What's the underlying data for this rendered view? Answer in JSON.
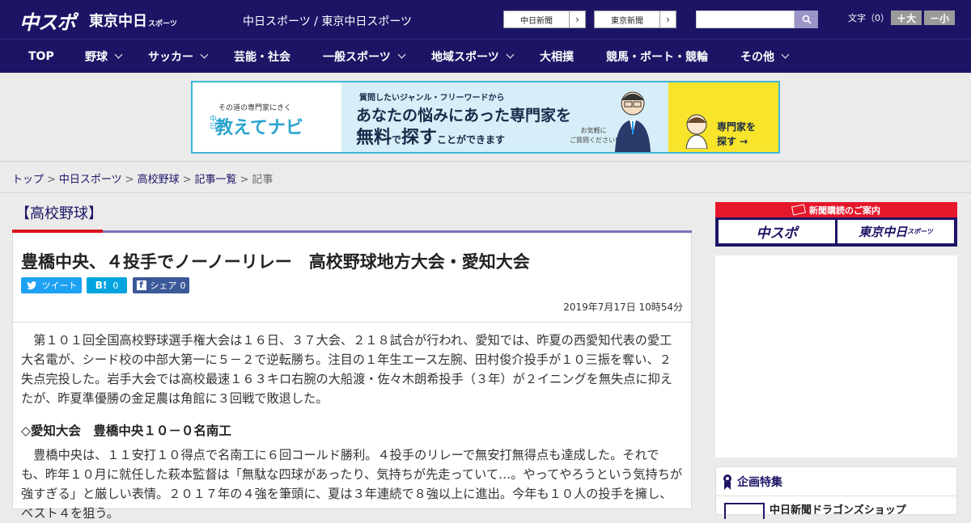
{
  "header": {
    "logo_main": "中スポ",
    "logo_tokyo": "東京中日",
    "logo_tokyo_sub": "スポーツ",
    "site_title": "中日スポーツ / 東京中日スポーツ",
    "links": [
      {
        "label": "中日新聞"
      },
      {
        "label": "東京新聞"
      }
    ],
    "search": {
      "placeholder": "",
      "icon": "search-icon"
    },
    "font_size": {
      "label": "文字（0）",
      "bigger": "＋大",
      "smaller": "－小"
    }
  },
  "nav": {
    "items": [
      {
        "label": "TOP",
        "dropdown": false
      },
      {
        "label": "野球",
        "dropdown": true
      },
      {
        "label": "サッカー",
        "dropdown": true
      },
      {
        "label": "芸能・社会",
        "dropdown": false
      },
      {
        "label": "一般スポーツ",
        "dropdown": true
      },
      {
        "label": "地域スポーツ",
        "dropdown": true
      },
      {
        "label": "大相撲",
        "dropdown": false
      },
      {
        "label": "競馬・ボート・競輪",
        "dropdown": false
      },
      {
        "label": "その他",
        "dropdown": true
      }
    ]
  },
  "banner": {
    "tagline": "その道の専門家にきく",
    "logo_prefix": "中日",
    "logo": "教えてナビ",
    "line1": "質問したいジャンル・フリーワードから",
    "line2": "あなたの悩みにあった専門家を",
    "line3_a": "無料",
    "line3_b": "で",
    "line3_c": "探す",
    "line3_d": "ことができます",
    "note_1": "お気軽に",
    "note_2": "ご質問ください!",
    "cta_1": "専門家を",
    "cta_2": "探す →"
  },
  "breadcrumb": {
    "items": [
      "トップ",
      "中日スポーツ",
      "高校野球",
      "記事一覧"
    ],
    "current": "記事",
    "separator": ">"
  },
  "article": {
    "category": "【高校野球】",
    "headline": "豊橋中央、４投手でノーノーリレー　高校野球地方大会・愛知大会",
    "share": {
      "tweet": "ツイート",
      "hatena": "B!",
      "hatena_count": "0",
      "facebook": "シェア",
      "facebook_count": "0"
    },
    "date": "2019年7月17日 10時54分",
    "para1": "第１０１回全国高校野球選手権大会は１６日、３７大会、２１８試合が行われ、愛知では、昨夏の西愛知代表の愛工大名電が、シード校の中部大第一に５－２で逆転勝ち。注目の１年生エース左腕、田村俊介投手が１０三振を奪い、２失点完投した。岩手大会では高校最速１６３キロ右腕の大船渡・佐々木朗希投手（３年）が２イニングを無失点に抑えたが、昨夏準優勝の金足農は角館に３回戦で敗退した。",
    "subhead": "◇愛知大会　豊橋中央１０－０名南工",
    "para2": "豊橋中央は、１１安打１０得点で名南工に６回コールド勝利。４投手のリレーで無安打無得点も達成した。それでも、昨年１０月に就任した萩本監督は「無駄な四球があったり、気持ちが先走っていて…。やってやろうという気持ちが強すぎる」と厳しい表情。２０１７年の４強を筆頭に、夏は３年連続で８強以上に進出。今年も１０人の投手を擁し、ベスト４を狙う。"
  },
  "sidebar": {
    "promo_head": "新聞購読のご案内",
    "promo_tile_1": "中スポ",
    "promo_tile_2": "東京中日",
    "promo_tile_2_sub": "スポーツ",
    "feature_head": "企画特集",
    "feature_item": "中日新聞ドラゴンズショップ"
  },
  "colors": {
    "brand_navy": "#1c1566",
    "accent_red": "#d7121f",
    "accent_purple": "#7f70b7",
    "twitter": "#1da1f2",
    "hatena": "#00a4de",
    "facebook": "#3b5998"
  }
}
